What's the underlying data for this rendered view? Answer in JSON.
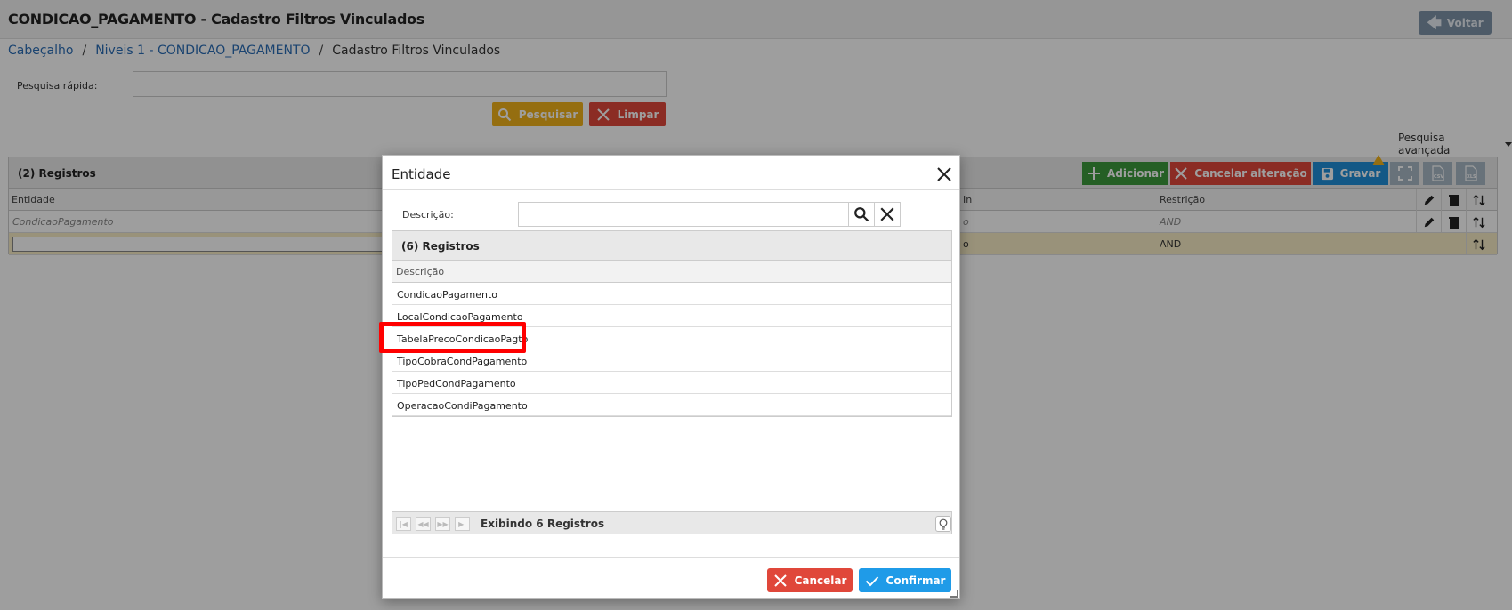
{
  "page": {
    "title": "CONDICAO_PAGAMENTO - Cadastro Filtros Vinculados",
    "back_label": "Voltar",
    "breadcrumb": [
      "Cabeçalho",
      "Niveis 1 - CONDICAO_PAGAMENTO",
      "Cadastro Filtros Vinculados"
    ],
    "breadcrumb_sep": "/",
    "quick_search_label": "Pesquisa rápida:",
    "quick_search_value": "",
    "search_btn": "Pesquisar",
    "clear_btn": "Limpar",
    "advanced_search": "Pesquisa avançada"
  },
  "grid": {
    "count": "(2) Registros",
    "add_btn": "Adicionar",
    "cancel_btn": "Cancelar alteração",
    "save_btn": "Gravar",
    "columns": {
      "entity": "Entidade",
      "in": "In",
      "restriction": "Restrição"
    },
    "rows": [
      {
        "entity": "CondicaoPagamento",
        "in_fragment": "o",
        "restriction": "AND"
      },
      {
        "entity": "",
        "in_fragment": "o",
        "restriction": "AND"
      }
    ]
  },
  "modal": {
    "title": "Entidade",
    "desc_label": "Descrição:",
    "desc_value": "",
    "count": "(6) Registros",
    "column": "Descrição",
    "items": [
      "CondicaoPagamento",
      "LocalCondicaoPagamento",
      "TabelaPrecoCondicaoPagto",
      "TipoCobraCondPagamento",
      "TipoPedCondPagamento",
      "OperacaoCondiPagamento"
    ],
    "pager_text": "Exibindo 6 Registros",
    "cancel_btn": "Cancelar",
    "confirm_btn": "Confirmar"
  },
  "colors": {
    "yellow": "#f0b21a",
    "red": "#e0473a",
    "green": "#3d9a3d",
    "blue": "#1f8fd8",
    "highlight": "#ff0000"
  }
}
